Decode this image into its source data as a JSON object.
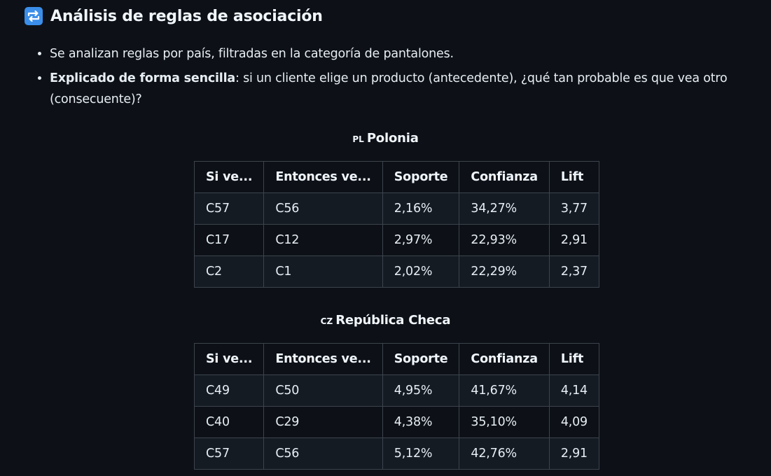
{
  "heading": {
    "icon": "repeat-arrows-icon",
    "title": "Análisis de reglas de asociación"
  },
  "bullets": [
    {
      "bold": "",
      "text": "Se analizan reglas por país, filtradas en la categoría de pantalones."
    },
    {
      "bold": "Explicado de forma sencilla",
      "text": ": si un cliente elige un producto (antecedente), ¿qué tan probable es que vea otro (consecuente)?"
    }
  ],
  "columns": [
    "Si ve...",
    "Entonces ve...",
    "Soporte",
    "Confianza",
    "Lift"
  ],
  "countries": [
    {
      "flag": "PL",
      "name": "Polonia",
      "rows": [
        [
          "C57",
          "C56",
          "2,16%",
          "34,27%",
          "3,77"
        ],
        [
          "C17",
          "C12",
          "2,97%",
          "22,93%",
          "2,91"
        ],
        [
          "C2",
          "C1",
          "2,02%",
          "22,29%",
          "2,37"
        ]
      ]
    },
    {
      "flag": "CZ",
      "name": "República Checa",
      "rows": [
        [
          "C49",
          "C50",
          "4,95%",
          "41,67%",
          "4,14"
        ],
        [
          "C40",
          "C29",
          "4,38%",
          "35,10%",
          "4,09"
        ],
        [
          "C57",
          "C56",
          "5,12%",
          "42,76%",
          "2,91"
        ]
      ]
    }
  ]
}
